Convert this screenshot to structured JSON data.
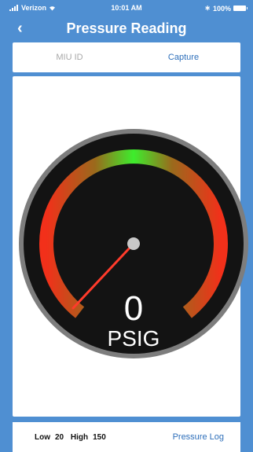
{
  "status_bar": {
    "carrier": "Verizon",
    "time": "10:01 AM",
    "battery_pct": "100%",
    "icons": [
      "signal-icon",
      "wifi-icon",
      "bluetooth-icon",
      "battery-icon"
    ]
  },
  "nav": {
    "back_icon": "chevron-left-icon",
    "title": "Pressure Reading"
  },
  "tabs": [
    {
      "label": "MIU ID",
      "active": false
    },
    {
      "label": "Capture",
      "active": true
    }
  ],
  "gauge": {
    "value": "0",
    "unit": "PSIG",
    "colors": {
      "dial": "#131313",
      "rim": "#7d7d7d",
      "arc_low": "#f2301a",
      "arc_mid": "#9a6a1c",
      "arc_high": "#3ded2d",
      "needle": "#ff3b2b",
      "hub": "#c8c8c8"
    }
  },
  "footer": {
    "low_label": "Low",
    "low_value": "20",
    "high_label": "High",
    "high_value": "150",
    "pressure_log_label": "Pressure Log"
  },
  "colors": {
    "header_bg": "#4f8fd2",
    "accent": "#2e6fba"
  }
}
